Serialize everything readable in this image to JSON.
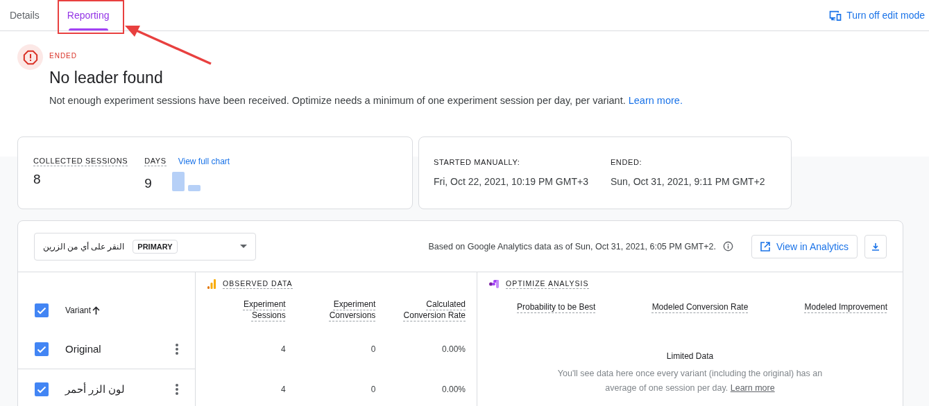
{
  "tabs": [
    {
      "label": "Details",
      "selected": false
    },
    {
      "label": "Reporting",
      "selected": true
    }
  ],
  "edit_mode_link": "Turn off edit mode",
  "status": {
    "label": "ENDED",
    "title": "No leader found",
    "description": "Not enough experiment sessions have been received. Optimize needs a minimum of one experiment session per day, per variant.",
    "link": "Learn more."
  },
  "summary": {
    "collected_sessions": {
      "label": "COLLECTED SESSIONS",
      "value": "8"
    },
    "days": {
      "label": "DAYS",
      "value": "9",
      "link": "View full chart"
    }
  },
  "dates": [
    {
      "label": "STARTED MANUALLY:",
      "value": "Fri, Oct 22, 2021, 10:19 PM GMT+3"
    },
    {
      "label": "ENDED:",
      "value": "Sun, Oct 31, 2021, 9:11 PM GMT+2"
    }
  ],
  "objective": {
    "name": "النقر على أي من الزرين",
    "badge": "PRIMARY"
  },
  "data_note": "Based on Google Analytics data as of Sun, Oct 31, 2021, 6:05 PM GMT+2.",
  "view_button": "View in Analytics",
  "table": {
    "select_all_checked": true,
    "variant_column": "Variant",
    "observed_header": "OBSERVED DATA",
    "analysis_header": "OPTIMIZE ANALYSIS",
    "observed_columns": [
      "Experiment Sessions",
      "Experiment Conversions",
      "Calculated Conversion Rate"
    ],
    "analysis_columns": [
      "Probability to be Best",
      "Modeled Conversion Rate",
      "Modeled Improvement"
    ],
    "rows": [
      {
        "name": "Original",
        "checked": true,
        "sessions": "4",
        "conversions": "0",
        "rate": "0.00%"
      },
      {
        "name": "لون الزر أحمر",
        "checked": true,
        "sessions": "4",
        "conversions": "0",
        "rate": "0.00%"
      }
    ]
  },
  "limited": {
    "title": "Limited Data",
    "text": "You'll see data here once every variant (including the original) has an average of one session per day.",
    "link": "Learn more"
  }
}
